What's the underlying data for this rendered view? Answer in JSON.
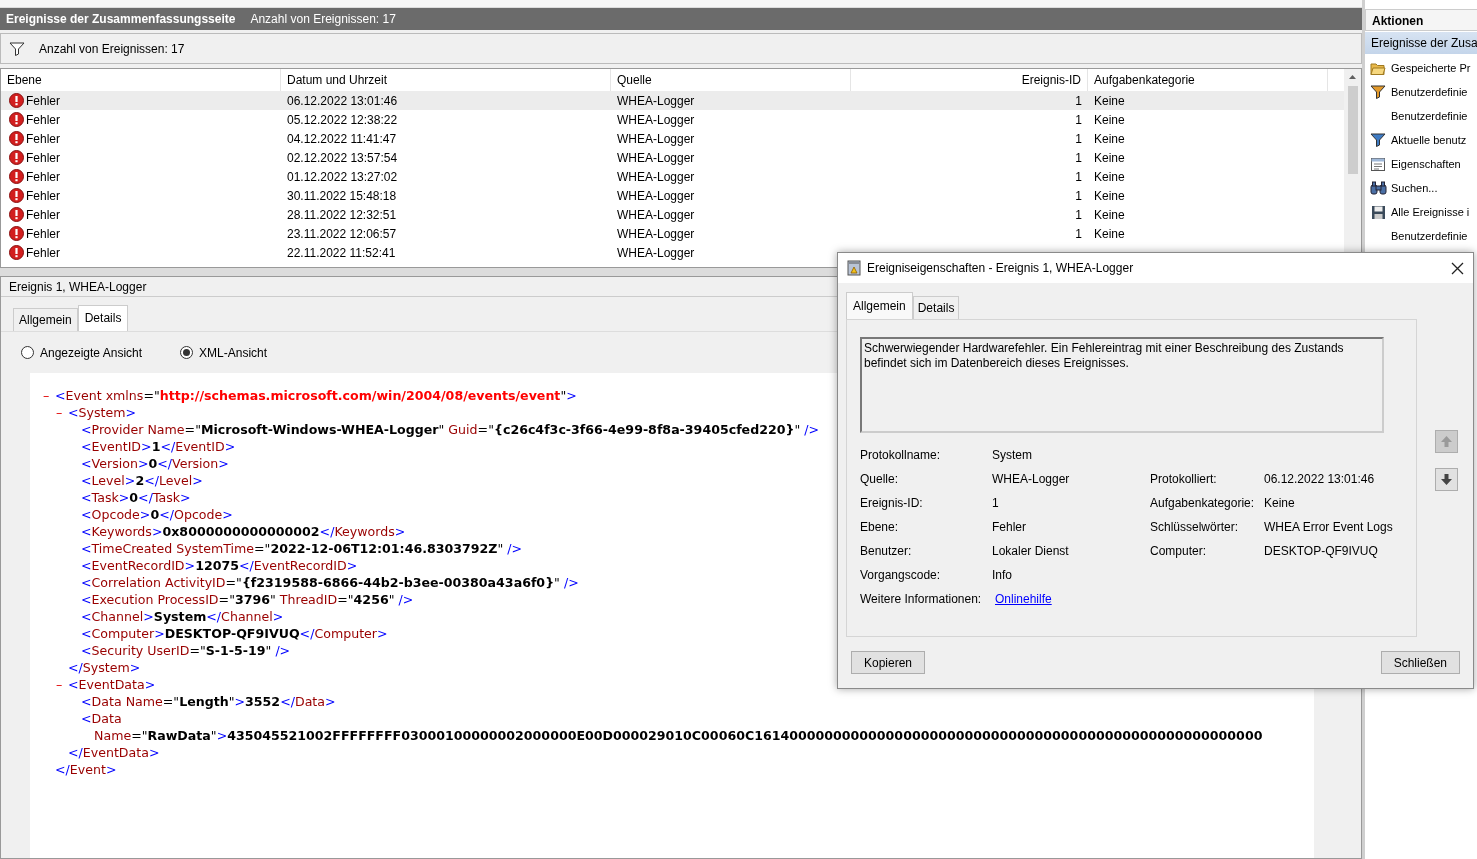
{
  "header": {
    "title": "Ereignisse der Zusammenfassungsseite",
    "count": "Anzahl von Ereignissen: 17"
  },
  "filter_bar": {
    "text": "Anzahl von Ereignissen: 17"
  },
  "events": {
    "columns": [
      "Ebene",
      "Datum und Uhrzeit",
      "Quelle",
      "Ereignis-ID",
      "Aufgabenkategorie"
    ],
    "rows": [
      {
        "level": "Fehler",
        "date": "06.12.2022 13:01:46",
        "source": "WHEA-Logger",
        "event_id": "1",
        "category": "Keine",
        "selected": true
      },
      {
        "level": "Fehler",
        "date": "05.12.2022 12:38:22",
        "source": "WHEA-Logger",
        "event_id": "1",
        "category": "Keine",
        "selected": false
      },
      {
        "level": "Fehler",
        "date": "04.12.2022 11:41:47",
        "source": "WHEA-Logger",
        "event_id": "1",
        "category": "Keine",
        "selected": false
      },
      {
        "level": "Fehler",
        "date": "02.12.2022 13:57:54",
        "source": "WHEA-Logger",
        "event_id": "1",
        "category": "Keine",
        "selected": false
      },
      {
        "level": "Fehler",
        "date": "01.12.2022 13:27:02",
        "source": "WHEA-Logger",
        "event_id": "1",
        "category": "Keine",
        "selected": false
      },
      {
        "level": "Fehler",
        "date": "30.11.2022 15:48:18",
        "source": "WHEA-Logger",
        "event_id": "1",
        "category": "Keine",
        "selected": false
      },
      {
        "level": "Fehler",
        "date": "28.11.2022 12:32:51",
        "source": "WHEA-Logger",
        "event_id": "1",
        "category": "Keine",
        "selected": false
      },
      {
        "level": "Fehler",
        "date": "23.11.2022 12:06:57",
        "source": "WHEA-Logger",
        "event_id": "1",
        "category": "Keine",
        "selected": false
      },
      {
        "level": "Fehler",
        "date": "22.11.2022 11:52:41",
        "source": "WHEA-Logger",
        "selected": false
      }
    ]
  },
  "details": {
    "title": "Ereignis 1, WHEA-Logger",
    "tabs": [
      {
        "label": "Allgemein",
        "selected": false
      },
      {
        "label": "Details",
        "selected": true
      }
    ],
    "views": [
      {
        "label": "Angezeigte Ansicht",
        "selected": false
      },
      {
        "label": "XML-Ansicht",
        "selected": true
      }
    ],
    "xml": {
      "toggle": "–",
      "open": [
        {
          "kind": "p",
          "text": "<"
        },
        {
          "kind": "t",
          "text": "Event"
        },
        {
          "kind": "a",
          "text": " xmlns"
        },
        {
          "kind": "q",
          "text": "=\""
        },
        {
          "kind": "u",
          "text": "http://schemas.microsoft.com/win/2004/08/events/event"
        },
        {
          "kind": "q",
          "text": "\""
        },
        {
          "kind": "p",
          "text": ">"
        }
      ],
      "children": [
        {
          "toggle": "–",
          "open": [
            {
              "kind": "p",
              "text": "<"
            },
            {
              "kind": "t",
              "text": "System"
            },
            {
              "kind": "p",
              "text": ">"
            }
          ],
          "children": [
            {
              "open": [
                {
                  "kind": "p",
                  "text": "<"
                },
                {
                  "kind": "t",
                  "text": "Provider"
                },
                {
                  "kind": "a",
                  "text": " Name"
                },
                {
                  "kind": "q",
                  "text": "=\""
                },
                {
                  "kind": "v",
                  "text": "Microsoft-Windows-WHEA-Logger"
                },
                {
                  "kind": "q",
                  "text": "\""
                },
                {
                  "kind": "a",
                  "text": " Guid"
                },
                {
                  "kind": "q",
                  "text": "=\""
                },
                {
                  "kind": "v",
                  "text": "{c26c4f3c-3f66-4e99-8f8a-39405cfed220}"
                },
                {
                  "kind": "q",
                  "text": "\""
                },
                {
                  "kind": "p",
                  "text": " />"
                }
              ]
            },
            {
              "open": [
                {
                  "kind": "p",
                  "text": "<"
                },
                {
                  "kind": "t",
                  "text": "EventID"
                },
                {
                  "kind": "p",
                  "text": ">"
                },
                {
                  "kind": "v",
                  "text": "1"
                },
                {
                  "kind": "p",
                  "text": "</"
                },
                {
                  "kind": "t",
                  "text": "EventID"
                },
                {
                  "kind": "p",
                  "text": ">"
                }
              ]
            },
            {
              "open": [
                {
                  "kind": "p",
                  "text": "<"
                },
                {
                  "kind": "t",
                  "text": "Version"
                },
                {
                  "kind": "p",
                  "text": ">"
                },
                {
                  "kind": "v",
                  "text": "0"
                },
                {
                  "kind": "p",
                  "text": "</"
                },
                {
                  "kind": "t",
                  "text": "Version"
                },
                {
                  "kind": "p",
                  "text": ">"
                }
              ]
            },
            {
              "open": [
                {
                  "kind": "p",
                  "text": "<"
                },
                {
                  "kind": "t",
                  "text": "Level"
                },
                {
                  "kind": "p",
                  "text": ">"
                },
                {
                  "kind": "v",
                  "text": "2"
                },
                {
                  "kind": "p",
                  "text": "</"
                },
                {
                  "kind": "t",
                  "text": "Level"
                },
                {
                  "kind": "p",
                  "text": ">"
                }
              ]
            },
            {
              "open": [
                {
                  "kind": "p",
                  "text": "<"
                },
                {
                  "kind": "t",
                  "text": "Task"
                },
                {
                  "kind": "p",
                  "text": ">"
                },
                {
                  "kind": "v",
                  "text": "0"
                },
                {
                  "kind": "p",
                  "text": "</"
                },
                {
                  "kind": "t",
                  "text": "Task"
                },
                {
                  "kind": "p",
                  "text": ">"
                }
              ]
            },
            {
              "open": [
                {
                  "kind": "p",
                  "text": "<"
                },
                {
                  "kind": "t",
                  "text": "Opcode"
                },
                {
                  "kind": "p",
                  "text": ">"
                },
                {
                  "kind": "v",
                  "text": "0"
                },
                {
                  "kind": "p",
                  "text": "</"
                },
                {
                  "kind": "t",
                  "text": "Opcode"
                },
                {
                  "kind": "p",
                  "text": ">"
                }
              ]
            },
            {
              "open": [
                {
                  "kind": "p",
                  "text": "<"
                },
                {
                  "kind": "t",
                  "text": "Keywords"
                },
                {
                  "kind": "p",
                  "text": ">"
                },
                {
                  "kind": "v",
                  "text": "0x8000000000000002"
                },
                {
                  "kind": "p",
                  "text": "</"
                },
                {
                  "kind": "t",
                  "text": "Keywords"
                },
                {
                  "kind": "p",
                  "text": ">"
                }
              ]
            },
            {
              "open": [
                {
                  "kind": "p",
                  "text": "<"
                },
                {
                  "kind": "t",
                  "text": "TimeCreated"
                },
                {
                  "kind": "a",
                  "text": " SystemTime"
                },
                {
                  "kind": "q",
                  "text": "=\""
                },
                {
                  "kind": "v",
                  "text": "2022-12-06T12:01:46.8303792Z"
                },
                {
                  "kind": "q",
                  "text": "\""
                },
                {
                  "kind": "p",
                  "text": " />"
                }
              ]
            },
            {
              "open": [
                {
                  "kind": "p",
                  "text": "<"
                },
                {
                  "kind": "t",
                  "text": "EventRecordID"
                },
                {
                  "kind": "p",
                  "text": ">"
                },
                {
                  "kind": "v",
                  "text": "12075"
                },
                {
                  "kind": "p",
                  "text": "</"
                },
                {
                  "kind": "t",
                  "text": "EventRecordID"
                },
                {
                  "kind": "p",
                  "text": ">"
                }
              ]
            },
            {
              "open": [
                {
                  "kind": "p",
                  "text": "<"
                },
                {
                  "kind": "t",
                  "text": "Correlation"
                },
                {
                  "kind": "a",
                  "text": " ActivityID"
                },
                {
                  "kind": "q",
                  "text": "=\""
                },
                {
                  "kind": "v",
                  "text": "{f2319588-6866-44b2-b3ee-00380a43a6f0}"
                },
                {
                  "kind": "q",
                  "text": "\""
                },
                {
                  "kind": "p",
                  "text": " />"
                }
              ]
            },
            {
              "open": [
                {
                  "kind": "p",
                  "text": "<"
                },
                {
                  "kind": "t",
                  "text": "Execution"
                },
                {
                  "kind": "a",
                  "text": " ProcessID"
                },
                {
                  "kind": "q",
                  "text": "=\""
                },
                {
                  "kind": "v",
                  "text": "3796"
                },
                {
                  "kind": "q",
                  "text": "\""
                },
                {
                  "kind": "a",
                  "text": " ThreadID"
                },
                {
                  "kind": "q",
                  "text": "=\""
                },
                {
                  "kind": "v",
                  "text": "4256"
                },
                {
                  "kind": "q",
                  "text": "\""
                },
                {
                  "kind": "p",
                  "text": " />"
                }
              ]
            },
            {
              "open": [
                {
                  "kind": "p",
                  "text": "<"
                },
                {
                  "kind": "t",
                  "text": "Channel"
                },
                {
                  "kind": "p",
                  "text": ">"
                },
                {
                  "kind": "v",
                  "text": "System"
                },
                {
                  "kind": "p",
                  "text": "</"
                },
                {
                  "kind": "t",
                  "text": "Channel"
                },
                {
                  "kind": "p",
                  "text": ">"
                }
              ]
            },
            {
              "open": [
                {
                  "kind": "p",
                  "text": "<"
                },
                {
                  "kind": "t",
                  "text": "Computer"
                },
                {
                  "kind": "p",
                  "text": ">"
                },
                {
                  "kind": "v",
                  "text": "DESKTOP-QF9IVUQ"
                },
                {
                  "kind": "p",
                  "text": "</"
                },
                {
                  "kind": "t",
                  "text": "Computer"
                },
                {
                  "kind": "p",
                  "text": ">"
                }
              ]
            },
            {
              "open": [
                {
                  "kind": "p",
                  "text": "<"
                },
                {
                  "kind": "t",
                  "text": "Security"
                },
                {
                  "kind": "a",
                  "text": " UserID"
                },
                {
                  "kind": "q",
                  "text": "=\""
                },
                {
                  "kind": "v",
                  "text": "S-1-5-19"
                },
                {
                  "kind": "q",
                  "text": "\""
                },
                {
                  "kind": "p",
                  "text": " />"
                }
              ]
            }
          ],
          "close": [
            {
              "kind": "p",
              "text": "</"
            },
            {
              "kind": "t",
              "text": "System"
            },
            {
              "kind": "p",
              "text": ">"
            }
          ]
        },
        {
          "toggle": "–",
          "open": [
            {
              "kind": "p",
              "text": "<"
            },
            {
              "kind": "t",
              "text": "EventData"
            },
            {
              "kind": "p",
              "text": ">"
            }
          ],
          "children": [
            {
              "open": [
                {
                  "kind": "p",
                  "text": "<"
                },
                {
                  "kind": "t",
                  "text": "Data"
                },
                {
                  "kind": "a",
                  "text": " Name"
                },
                {
                  "kind": "q",
                  "text": "=\""
                },
                {
                  "kind": "v",
                  "text": "Length"
                },
                {
                  "kind": "q",
                  "text": "\""
                },
                {
                  "kind": "p",
                  "text": ">"
                },
                {
                  "kind": "v",
                  "text": "3552"
                },
                {
                  "kind": "p",
                  "text": "</"
                },
                {
                  "kind": "t",
                  "text": "Data"
                },
                {
                  "kind": "p",
                  "text": ">"
                }
              ]
            },
            {
              "open": [
                {
                  "kind": "p",
                  "text": "<"
                },
                {
                  "kind": "t",
                  "text": "Data"
                }
              ],
              "continued": [
                {
                  "kind": "a",
                  "text": "Name"
                },
                {
                  "kind": "q",
                  "text": "=\""
                },
                {
                  "kind": "v",
                  "text": "RawData"
                },
                {
                  "kind": "q",
                  "text": "\""
                },
                {
                  "kind": "p",
                  "text": ">"
                },
                {
                  "kind": "v",
                  "text": "435045521002FFFFFFFF03000100000002000000E00D000029010C00060C1614000000000000000000000000000000000000000000000000000000"
                }
              ]
            }
          ],
          "close": [
            {
              "kind": "p",
              "text": "</"
            },
            {
              "kind": "t",
              "text": "EventData"
            },
            {
              "kind": "p",
              "text": ">"
            }
          ]
        }
      ],
      "close": [
        {
          "kind": "p",
          "text": "</"
        },
        {
          "kind": "t",
          "text": "Event"
        },
        {
          "kind": "p",
          "text": ">"
        }
      ]
    }
  },
  "actions": {
    "title": "Aktionen",
    "section": "Ereignisse der Zusa",
    "items": [
      "Gespeicherte Pr",
      "Benutzerdefinie",
      "Benutzerdefinie",
      "Aktuelle benutz",
      "Eigenschaften",
      "Suchen...",
      "Alle Ereignisse i",
      "Benutzerdefinie"
    ]
  },
  "dialog": {
    "title": "Ereigniseigenschaften - Ereignis 1, WHEA-Logger",
    "tabs": [
      {
        "label": "Allgemein",
        "selected": true
      },
      {
        "label": "Details",
        "selected": false
      }
    ],
    "description": "Schwerwiegender Hardwarefehler. Ein Fehlereintrag mit einer Beschreibung des Zustands befindet sich im Datenbereich dieses Ereignisses.",
    "rows": [
      {
        "left": {
          "label": "Protokollname:",
          "value": "System",
          "kind": "text"
        }
      },
      {
        "left": {
          "label": "Quelle:",
          "value": "WHEA-Logger",
          "kind": "text"
        },
        "right": {
          "label": "Protokolliert:",
          "value": "06.12.2022 13:01:46",
          "kind": "text"
        }
      },
      {
        "left": {
          "label": "Ereignis-ID:",
          "value": "1",
          "kind": "text"
        },
        "right": {
          "label": "Aufgabenkategorie:",
          "value": "Keine",
          "kind": "text"
        }
      },
      {
        "left": {
          "label": "Ebene:",
          "value": "Fehler",
          "kind": "text"
        },
        "right": {
          "label": "Schlüsselwörter:",
          "value": "WHEA Error Event Logs",
          "kind": "text"
        }
      },
      {
        "left": {
          "label": "Benutzer:",
          "value": "Lokaler Dienst",
          "kind": "text"
        },
        "right": {
          "label": "Computer:",
          "value": "DESKTOP-QF9IVUQ",
          "kind": "text"
        }
      },
      {
        "left": {
          "label": "Vorgangscode:",
          "value": "Info",
          "kind": "text"
        }
      },
      {
        "left": {
          "label": "Weitere Informationen:",
          "value": "Onlinehilfe",
          "kind": "link"
        }
      }
    ],
    "nav_buttons": [
      {
        "disabled": true
      },
      {
        "disabled": false
      }
    ],
    "buttons": [
      "Kopieren",
      "Schließen"
    ]
  }
}
